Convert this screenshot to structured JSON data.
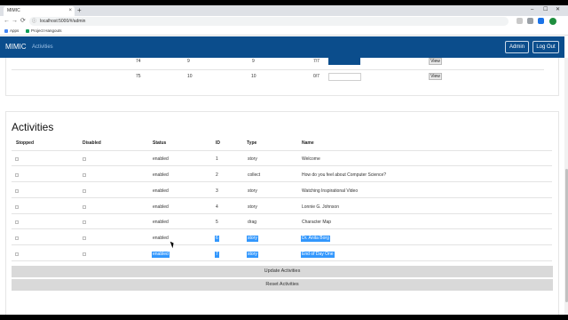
{
  "browser": {
    "tab_title": "MIMIC",
    "tab_close": "×",
    "new_tab": "+",
    "url": "localhost:5000/#/admin",
    "bookmarks": [
      "Apps",
      "Project Hangouts"
    ],
    "window_controls": [
      "–",
      "☐",
      "✕"
    ],
    "nav": [
      "←",
      "→",
      "⟳"
    ]
  },
  "navbar": {
    "brand": "MIMIC",
    "link": "Activities",
    "admin_label": "Admin",
    "logout_label": "Log Out"
  },
  "top_table": {
    "rows": [
      {
        "id": "74",
        "a": "9",
        "b": "9",
        "c": "7/7",
        "view": "View"
      },
      {
        "id": "75",
        "a": "10",
        "b": "10",
        "c": "0/7",
        "view": "View"
      }
    ]
  },
  "activities": {
    "title": "Activities",
    "headers": [
      "Stopped",
      "Disabled",
      "Status",
      "ID",
      "Type",
      "Name"
    ],
    "rows": [
      {
        "status": "enabled",
        "id": "1",
        "type": "story",
        "name": "Welcome"
      },
      {
        "status": "enabled",
        "id": "2",
        "type": "collect",
        "name": "How do you feel about Computer Science?"
      },
      {
        "status": "enabled",
        "id": "3",
        "type": "story",
        "name": "Watching Inspirational Video"
      },
      {
        "status": "enabled",
        "id": "4",
        "type": "story",
        "name": "Lonnie G. Johnson"
      },
      {
        "status": "enabled",
        "id": "5",
        "type": "drag",
        "name": "Character Map"
      },
      {
        "status": "enabled",
        "id": "6",
        "type": "story",
        "name": "Dr. Anita Borg"
      },
      {
        "status": "enabled",
        "id": "7",
        "type": "story",
        "name": "End of Day One"
      }
    ],
    "update_label": "Update Activities",
    "reset_label": "Reset Activities"
  },
  "colors": {
    "navbar": "#0b4d8c",
    "selection": "#3297fd"
  }
}
